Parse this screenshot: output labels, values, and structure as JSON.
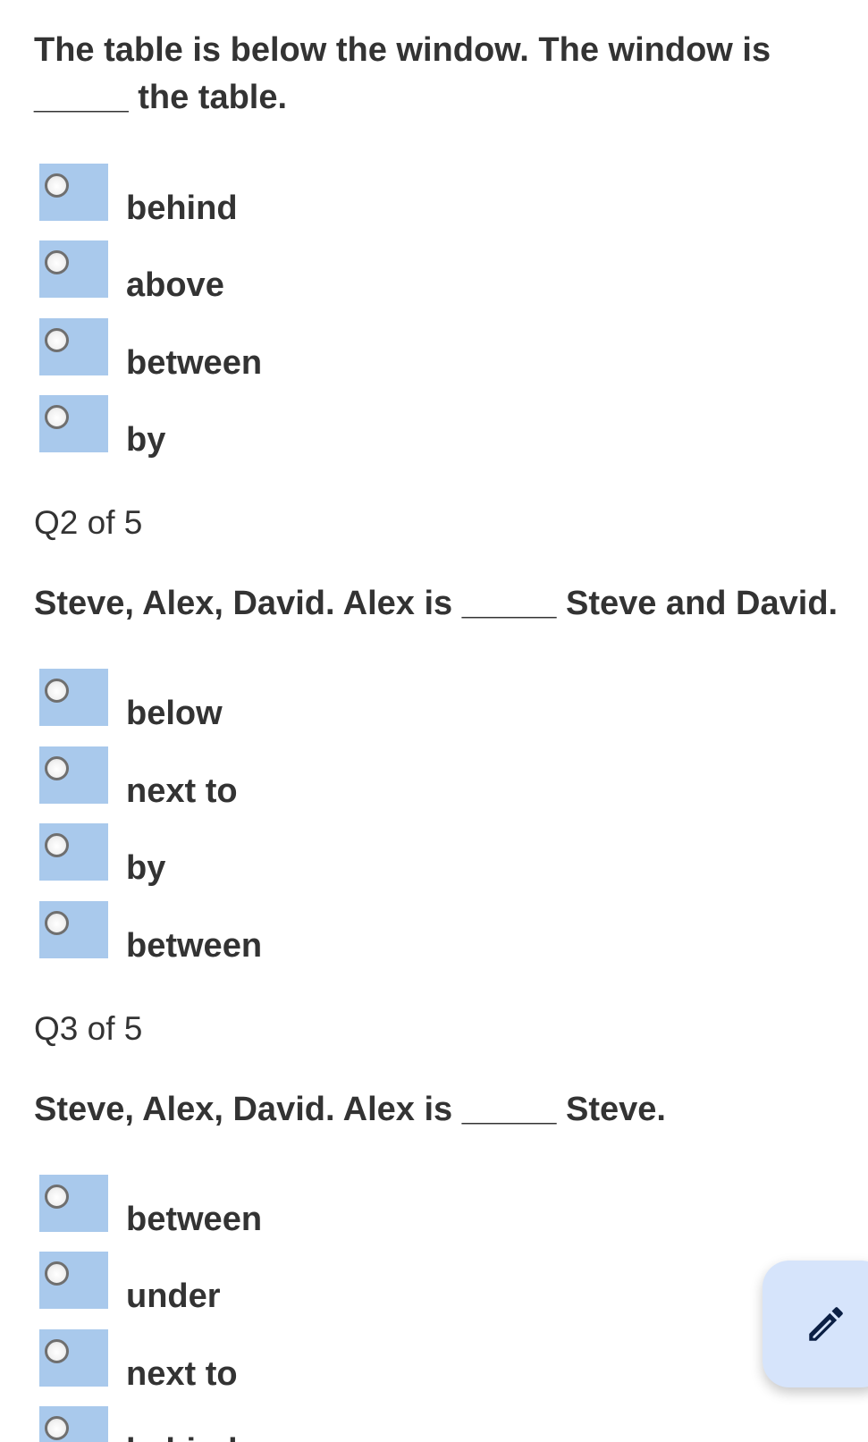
{
  "q1": {
    "text_line1": "The table is below the window. The window is",
    "text_line2": "_____ the table.",
    "options": [
      "behind",
      "above",
      "between",
      "by"
    ]
  },
  "q2": {
    "counter": "Q2 of 5",
    "text": "Steve, Alex, David. Alex is _____ Steve and David.",
    "options": [
      "below",
      "next to",
      "by",
      "between"
    ]
  },
  "q3": {
    "counter": "Q3 of 5",
    "text": "Steve, Alex, David. Alex is _____ Steve.",
    "options": [
      "between",
      "under",
      "next to",
      "behind"
    ]
  },
  "fab": {
    "icon": "pencil-icon",
    "background": "#d6e4fb"
  },
  "colors": {
    "radio_box": "#a9c9ec",
    "text": "#333333"
  }
}
